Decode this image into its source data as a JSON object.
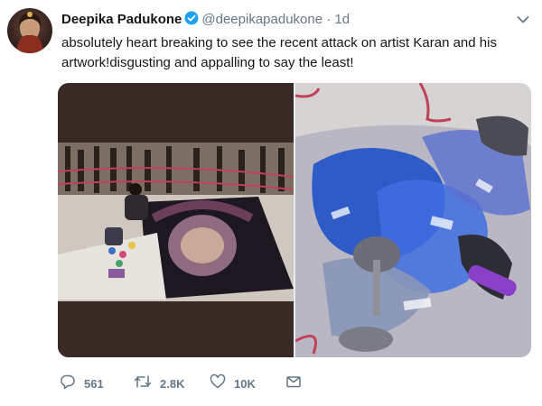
{
  "tweet": {
    "display_name": "Deepika Padukone",
    "handle": "@deepikapadukone",
    "separator": "·",
    "time": "1d",
    "text": "absolutely heart breaking to see the recent attack on artist Karan and his artwork!disgusting and appalling to say the least!"
  },
  "actions": {
    "reply_count": "561",
    "retweet_count": "2.8K",
    "like_count": "10K"
  },
  "colors": {
    "verified": "#1da1f2",
    "secondary_text": "#657786",
    "primary_text": "#14171a"
  },
  "icons": [
    "verified-badge-icon",
    "chevron-down-icon",
    "reply-icon",
    "retweet-icon",
    "like-icon",
    "direct-message-icon"
  ]
}
